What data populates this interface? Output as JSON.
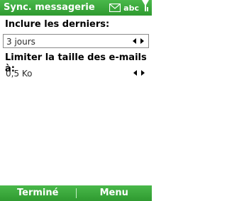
{
  "titlebar": {
    "title": "Sync. messagerie",
    "input_mode": "abc"
  },
  "form": {
    "include_label": "Inclure les derniers:",
    "include_value": "3 jours",
    "limit_label": "Limiter la taille des e-mails à:",
    "limit_value": "0,5 Ko"
  },
  "softkeys": {
    "left": "Terminé",
    "right": "Menu"
  }
}
